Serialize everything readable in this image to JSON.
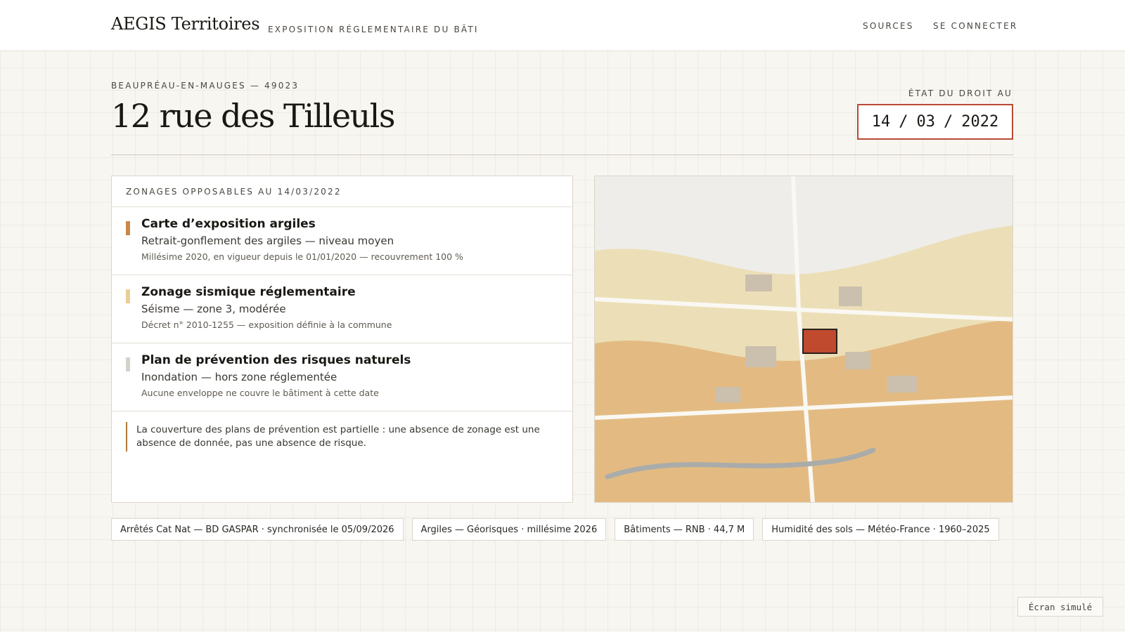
{
  "header": {
    "brand": "AEGIS Territoires",
    "tagline": "EXPOSITION RÉGLEMENTAIRE DU BÂTI",
    "nav": {
      "sources": "SOURCES",
      "login": "SE CONNECTER"
    }
  },
  "location": {
    "commune": "BEAUPRÉAU-EN-MAUGES — 49023",
    "address": "12 rue des Tilleuls"
  },
  "date_picker": {
    "label": "ÉTAT DU DROIT AU",
    "day": "14",
    "month": "03",
    "year": "2022",
    "separator": "/"
  },
  "zones": {
    "heading": "ZONAGES OPPOSABLES AU 14/03/2022",
    "items": [
      {
        "title": "Carte d’exposition argiles",
        "subtitle": "Retrait-gonflement des argiles — niveau moyen",
        "meta": "Millésime 2020, en vigueur depuis le 01/01/2020 — recouvrement 100 %",
        "color": "#c8884a"
      },
      {
        "title": "Zonage sismique réglementaire",
        "subtitle": "Séisme — zone 3, modérée",
        "meta": "Décret n° 2010-1255 — exposition définie à la commune",
        "color": "#e8cf95"
      },
      {
        "title": "Plan de prévention des risques naturels",
        "subtitle": "Inondation — hors zone réglementée",
        "meta": "Aucune enveloppe ne couvre le bâtiment à cette date",
        "color": "#d6d2cb"
      }
    ],
    "note": "La couverture des plans de prévention est partielle : une absence de zonage est une absence de donnée, pas une absence de risque."
  },
  "map": {
    "colors": {
      "background": "#eeede9",
      "zone_light": "#ecdfb7",
      "zone_medium": "#e3bb82",
      "road": "#faf8f3",
      "building": "#cbbfae",
      "target": "#bf4a2e",
      "river": "#a9acaa"
    }
  },
  "sources": [
    "Arrêtés Cat Nat — BD GASPAR · synchronisée le 05/09/2026",
    "Argiles — Géorisques · millésime 2026",
    "Bâtiments — RNB · 44,7 M",
    "Humidité des sols — Météo-France · 1960–2025"
  ],
  "badge": "Écran simulé"
}
